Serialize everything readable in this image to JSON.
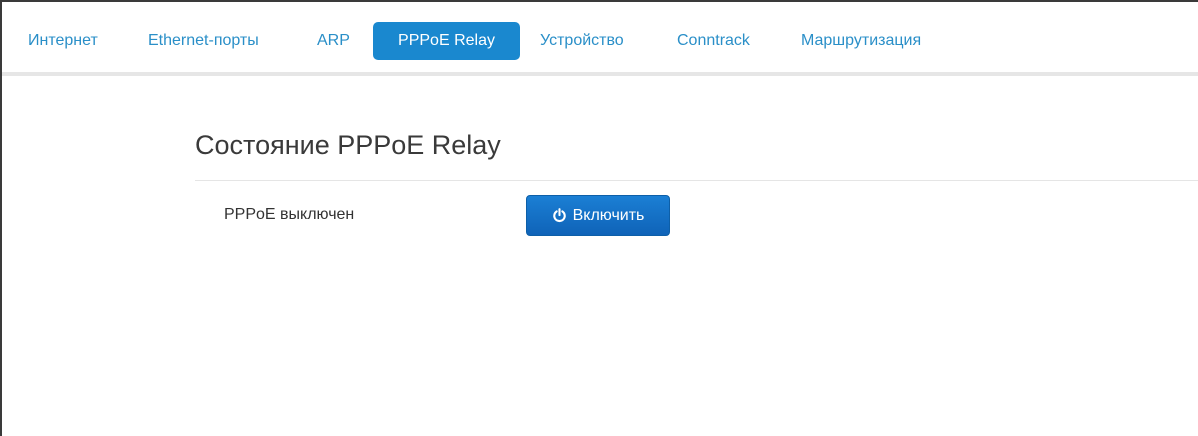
{
  "tabs": [
    {
      "label": "Интернет"
    },
    {
      "label": "Ethernet-порты"
    },
    {
      "label": "ARP"
    },
    {
      "label": "PPPoE Relay",
      "active": true
    },
    {
      "label": "Устройство"
    },
    {
      "label": "Conntrack"
    },
    {
      "label": "Маршрутизация"
    }
  ],
  "section": {
    "title": "Состояние PPPoE Relay",
    "status_label": "PPPoE выключен",
    "enable_button": {
      "label": "Включить",
      "icon": "power-icon"
    }
  },
  "colors": {
    "accent": "#1a88cf",
    "link": "#2a8fc8",
    "button": "#0f63b8"
  }
}
